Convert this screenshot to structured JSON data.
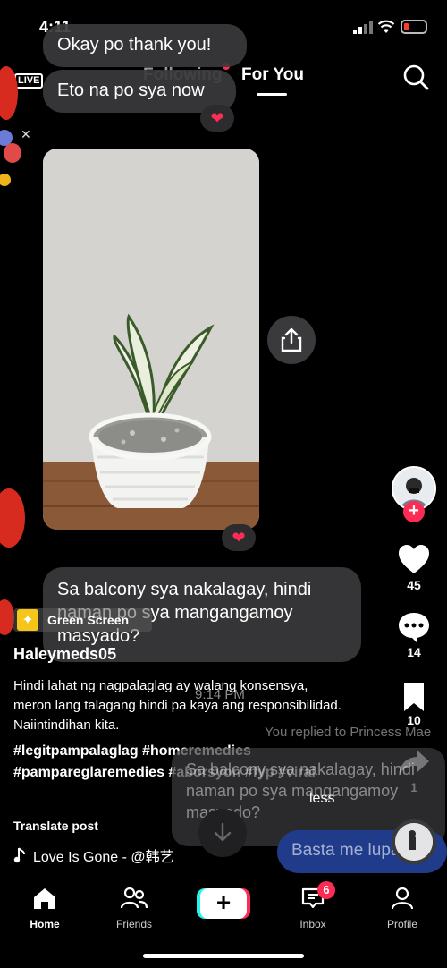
{
  "status_bar": {
    "time": "4:11"
  },
  "top_nav": {
    "live_label": "LIVE",
    "tabs": [
      {
        "label": "Following"
      },
      {
        "label": "For You"
      }
    ]
  },
  "chat": {
    "bubble1": "Okay po thank you!",
    "bubble2": "Eto na po sya now",
    "bubble3": "Sa balcony sya nakalagay, hindi naman po sya mangangamoy masyado?",
    "heart": "❤"
  },
  "sidebar": {
    "likes": "45",
    "comments": "14",
    "saves": "10",
    "shares": "1"
  },
  "post": {
    "effect_label": "Green Screen",
    "username": "Haleymeds05",
    "caption": "Hindi lahat ng nagpalaglag ay walang konsensya, meron lang talagang hindi pa kaya ang responsibilidad. Naiintindihan kita.",
    "hashtags": "#legitpampalaglag #homeremedies #pampareglaremedies #aborsyon #fyp #viral",
    "translate": "Translate post",
    "music": "Love Is Gone - @韩艺"
  },
  "overlay": {
    "time": "9:14 PM",
    "reply_note": "You replied to Princess Mae",
    "ghost_message": "Sa balcony sya nakalagay, hindi naman po sya mangangamoy masyado?",
    "less": "less",
    "reply_pill": "Basta me lupa se"
  },
  "bottom_nav": {
    "items": [
      {
        "label": "Home"
      },
      {
        "label": "Friends"
      },
      {
        "label": ""
      },
      {
        "label": "Inbox"
      },
      {
        "label": "Profile"
      }
    ],
    "inbox_badge": "6"
  },
  "colors": {
    "accent": "#fe2c55",
    "accent_cyan": "#25f4ee",
    "bubble": "#3a3a3c"
  }
}
